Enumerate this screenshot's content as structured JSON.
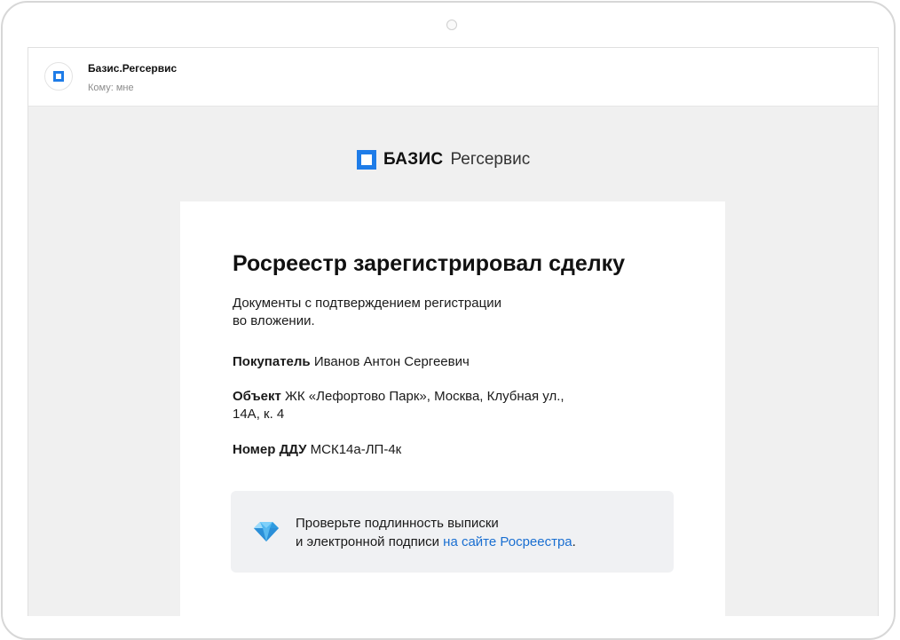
{
  "header": {
    "sender": "Базис.Регсервис",
    "recipient": "Кому: мне"
  },
  "brand": {
    "bold": "БАЗИС",
    "light": "Регсервис"
  },
  "email": {
    "title": "Росреестр зарегистрировал сделку",
    "intro_line1": "Документы с подтверждением регистрации",
    "intro_line2": "во вложении.",
    "buyer_label": "Покупатель",
    "buyer_value": "Иванов Антон Сергеевич",
    "object_label": "Объект",
    "object_value_line1": "ЖК «Лефортово Парк», Москва, Клубная ул.,",
    "object_value_line2": "14А, к. 4",
    "ddu_label": "Номер ДДУ",
    "ddu_value": "МСК14а-ЛП-4к"
  },
  "notice": {
    "line1": "Проверьте подлинность выписки",
    "line2": "и электронной подписи",
    "link": "на сайте Росреестра",
    "period": "."
  },
  "colors": {
    "brand_blue": "#1e7ce8",
    "link_blue": "#1a6fd1",
    "background_gray": "#f0f0f0"
  },
  "icons": {
    "avatar": "basis-logo-icon",
    "brand": "basis-square-icon",
    "notice": "diamond-gem-icon"
  }
}
